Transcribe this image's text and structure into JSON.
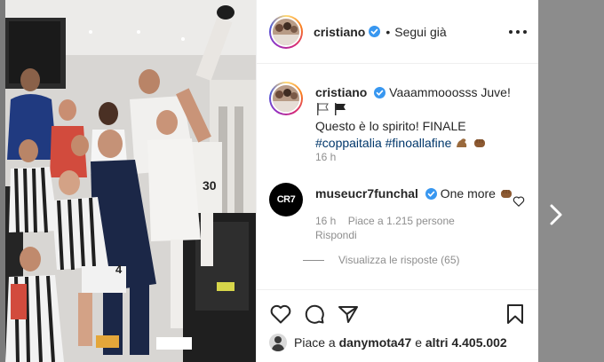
{
  "header": {
    "username": "cristiano",
    "separator": "•",
    "follow_label": "Segui già"
  },
  "caption": {
    "username": "cristiano",
    "text": "Vaaammooosss Juve!",
    "line2": "Questo è lo spirito! FINALE",
    "hashtag1": "#coppaitalia",
    "hashtag2": "#finoallafine",
    "emojis": [
      "white-flag",
      "black-flag",
      "flexed-biceps",
      "fist-bump"
    ],
    "time": "16 h"
  },
  "comment": {
    "avatar_text": "CR7",
    "username": "museucr7funchal",
    "text": "One more",
    "emoji": "fist-bump",
    "time": "16 h",
    "likes": "Piace a 1.215 persone",
    "reply_label": "Rispondi",
    "view_replies": "Visualizza le risposte (65)"
  },
  "likes": {
    "prefix": "Piace a",
    "user": "danymota47",
    "middle": "e",
    "others": "altri 4.405.002"
  },
  "photo": {
    "jersey_number": "30",
    "jersey_number_2": "4"
  },
  "colors": {
    "text": "#262626",
    "secondary": "#8e8e8e",
    "hashtag": "#00376b",
    "verified": "#3897f0",
    "separator": "#efefef"
  },
  "icons": [
    "verified-badge-icon",
    "more-options-icon",
    "heart-icon",
    "comment-icon",
    "share-icon",
    "bookmark-icon",
    "next-arrow-icon"
  ]
}
